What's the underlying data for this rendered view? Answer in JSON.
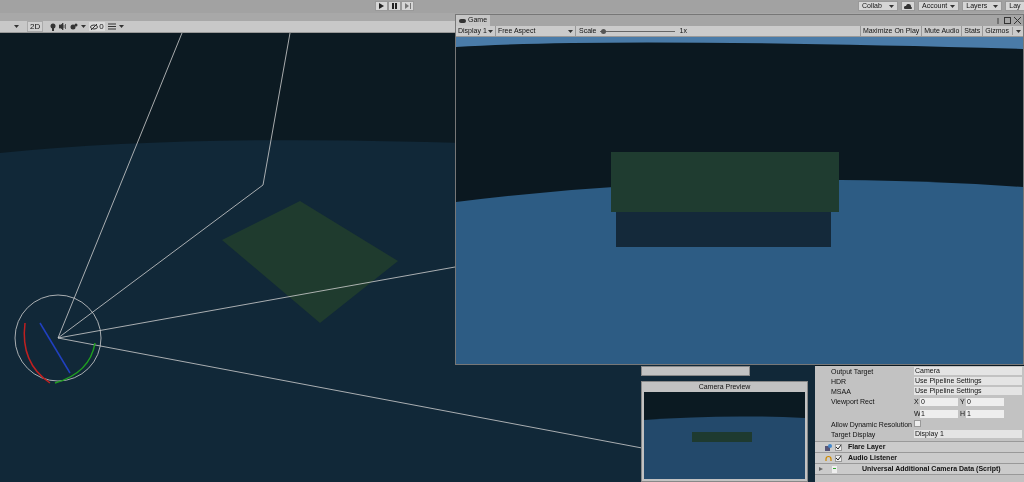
{
  "top_toolbar": {
    "right_buttons": [
      {
        "label": "Collab",
        "kind": "dropdown"
      },
      {
        "label": "Account",
        "kind": "dropdown"
      },
      {
        "label": "Layers",
        "kind": "dropdown"
      },
      {
        "label": "Lay",
        "kind": "plain"
      }
    ]
  },
  "scene_toolbar": {
    "mode_2d": "2D",
    "gizmo_count": "0"
  },
  "game_window": {
    "title": "Game",
    "display": "Display 1",
    "aspect": "Free Aspect",
    "scale_label": "Scale",
    "scale": {
      "level": 0.02
    },
    "scale_value": "1x",
    "buttons": [
      "Maximize On Play",
      "Mute Audio",
      "Stats",
      "Gizmos"
    ]
  },
  "camera_preview": {
    "title": "Camera Preview"
  },
  "inspector": {
    "fields": [
      {
        "label": "Output Target",
        "kind": "value",
        "value": "Camera"
      },
      {
        "label": "HDR",
        "kind": "value",
        "value": "Use Pipeline Settings"
      },
      {
        "label": "MSAA",
        "kind": "value",
        "value": "Use Pipeline Settings"
      },
      {
        "label": "Viewport Rect",
        "kind": "rect",
        "parts": [
          {
            "axis": "X",
            "value": "0"
          },
          {
            "axis": "Y",
            "value": "0"
          },
          {
            "axis": "W",
            "value": "1"
          },
          {
            "axis": "H",
            "value": "1"
          }
        ]
      },
      {
        "label": "Allow Dynamic Resolution",
        "kind": "checkbox",
        "checked": false
      },
      {
        "label": "Target Display",
        "kind": "value",
        "value": "Display 1"
      }
    ],
    "components": [
      {
        "name": "Flare Layer",
        "kind": "toggle",
        "checked": true
      },
      {
        "name": "Audio Listener",
        "kind": "toggle",
        "checked": true
      },
      {
        "name": "Universal Additional Camera Data (Script)",
        "kind": "script",
        "expanded": false
      }
    ]
  }
}
